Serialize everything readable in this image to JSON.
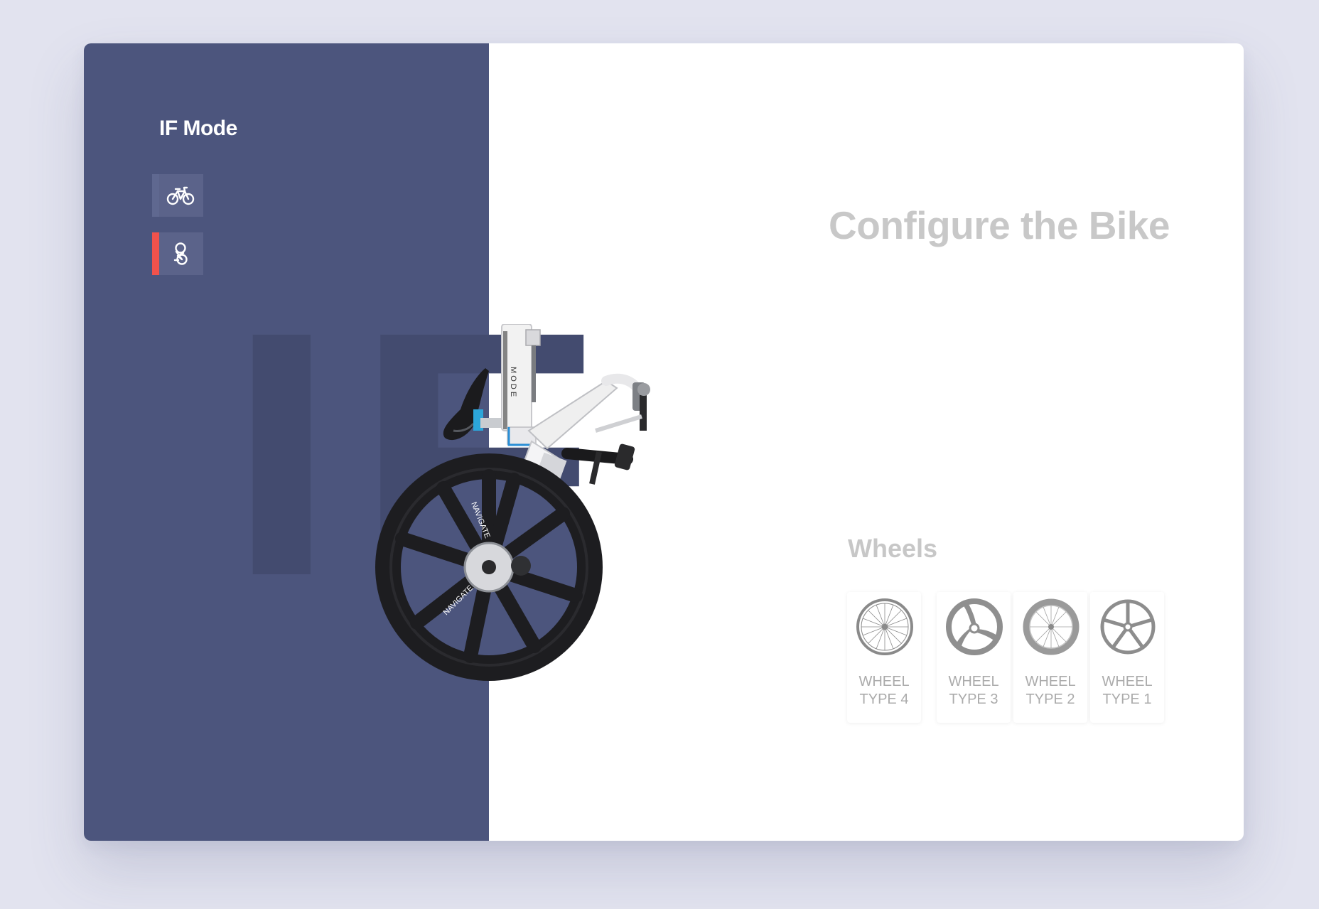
{
  "sidebar": {
    "title": "IF Mode",
    "modes": [
      {
        "icon": "bicycle-icon",
        "active": false
      },
      {
        "icon": "folded-bike-icon",
        "active": true
      }
    ],
    "watermark": "IF"
  },
  "main": {
    "headline": "Configure the Bike",
    "section_label": "Wheels",
    "wheels": [
      {
        "label": "WHEEL\nTYPE 4",
        "icon": "spoked-wheel-icon"
      },
      {
        "label": "WHEEL\nTYPE 3",
        "icon": "tri-spoke-wheel-icon"
      },
      {
        "label": "WHEEL\nTYPE 2",
        "icon": "deep-rim-wheel-icon"
      },
      {
        "label": "WHEEL\nTYPE 1",
        "icon": "five-spoke-wheel-icon"
      }
    ]
  },
  "colors": {
    "panel": "#4c557d",
    "accent": "#f0524c",
    "headline": "#c8c8c8"
  }
}
